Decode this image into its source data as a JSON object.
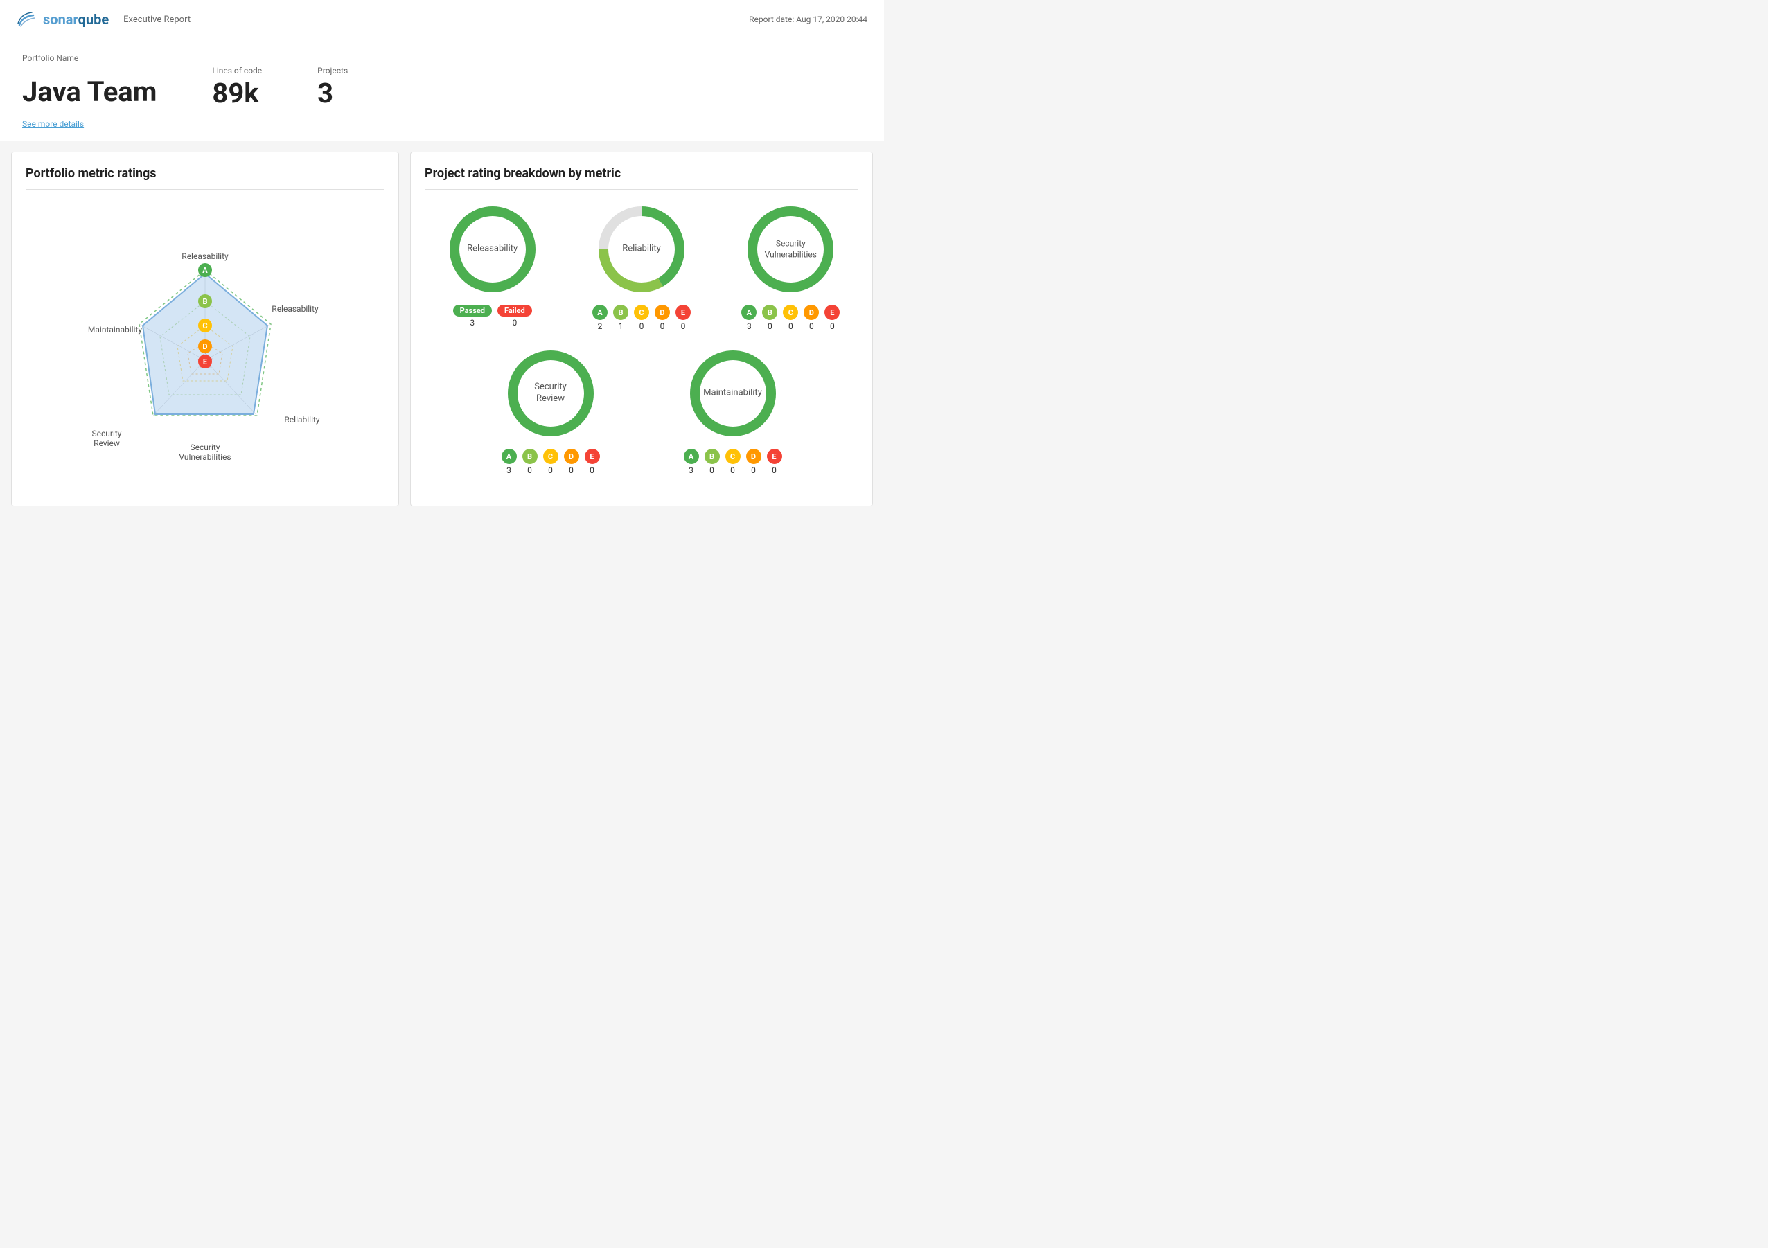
{
  "header": {
    "logo_text_1": "sonar",
    "logo_text_2": "qube",
    "subtitle": "Executive Report",
    "report_date_label": "Report date:",
    "report_date": "Aug 17, 2020 20:44"
  },
  "portfolio": {
    "label": "Portfolio Name",
    "name": "Java Team",
    "see_more": "See more details"
  },
  "stats": {
    "loc_label": "Lines of code",
    "loc_value": "89k",
    "projects_label": "Projects",
    "projects_value": "3"
  },
  "left_panel": {
    "title": "Portfolio metric ratings",
    "axes": {
      "top": "A",
      "top_left": "Maintainability",
      "top_right": "Releasability",
      "right": "Reliability",
      "bottom_right": "Security\nVulnerabilities",
      "bottom": "Security\nVulnerabilities",
      "bottom_left": "Security\nReview",
      "left": "Security\nReview"
    },
    "ratings": [
      "A",
      "B",
      "C",
      "D",
      "E"
    ]
  },
  "right_panel": {
    "title": "Project rating breakdown by metric",
    "metrics": [
      {
        "id": "releasability",
        "label": "Releasability",
        "donut_green_pct": 100,
        "passed": 3,
        "failed": 0,
        "type": "pass_fail"
      },
      {
        "id": "reliability",
        "label": "Reliability",
        "donut_a": 2,
        "donut_b": 1,
        "donut_c": 0,
        "donut_d": 0,
        "donut_e": 0,
        "type": "abcde",
        "counts": [
          2,
          1,
          0,
          0,
          0
        ]
      },
      {
        "id": "security_vulnerabilities",
        "label": "Security\nVulnerabilities",
        "type": "abcde",
        "counts": [
          3,
          0,
          0,
          0,
          0
        ]
      },
      {
        "id": "security_review",
        "label": "Security\nReview",
        "type": "abcde",
        "counts": [
          3,
          0,
          0,
          0,
          0
        ]
      },
      {
        "id": "maintainability",
        "label": "Maintainability",
        "type": "abcde",
        "counts": [
          3,
          0,
          0,
          0,
          0
        ]
      }
    ]
  },
  "colors": {
    "green": "#4caf50",
    "light_green": "#8bc34a",
    "yellow": "#ffc107",
    "orange": "#ff9800",
    "red": "#f44336",
    "blue_fill": "rgba(173,216,230,0.5)",
    "blue_stroke": "#5b9bd5",
    "grid_green": "#4caf50"
  }
}
